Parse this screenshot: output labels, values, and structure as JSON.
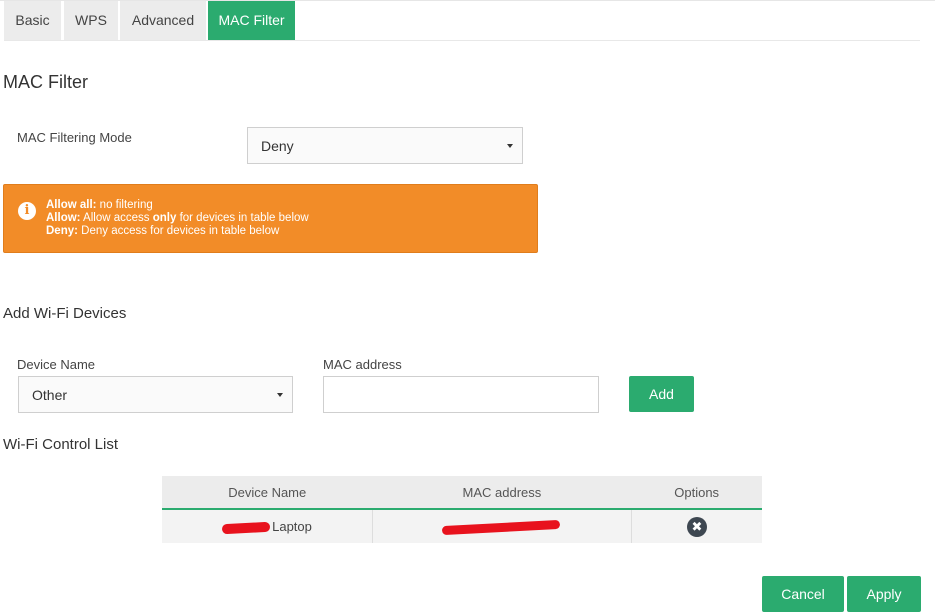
{
  "tabs": [
    {
      "label": "Basic"
    },
    {
      "label": "WPS"
    },
    {
      "label": "Advanced"
    },
    {
      "label": "MAC Filter"
    }
  ],
  "active_tab": "MAC Filter",
  "page_title": "MAC Filter",
  "mac_filter": {
    "mode_label": "MAC Filtering Mode",
    "mode_value": "Deny"
  },
  "info_box": {
    "line1_key": "Allow all:",
    "line1_text": " no filtering",
    "line2_key": "Allow:",
    "line2_pre": " Allow access ",
    "line2_emph": "only",
    "line2_post": " for devices in table below",
    "line3_key": "Deny:",
    "line3_text": " Deny access for devices in table below",
    "color": "#f28c28"
  },
  "add_section": {
    "title": "Add Wi-Fi Devices",
    "device_name_label": "Device Name",
    "device_name_value": "Other",
    "mac_label": "MAC address",
    "mac_value": "",
    "add_button": "Add"
  },
  "control_list": {
    "title": "Wi-Fi Control List",
    "columns": [
      "Device Name",
      "MAC address",
      "Options"
    ],
    "rows": [
      {
        "device_name": "Laptop",
        "mac": "",
        "option_icon": "delete-icon"
      }
    ]
  },
  "footer": {
    "cancel": "Cancel",
    "apply": "Apply"
  },
  "accent_color": "#2bab6f"
}
